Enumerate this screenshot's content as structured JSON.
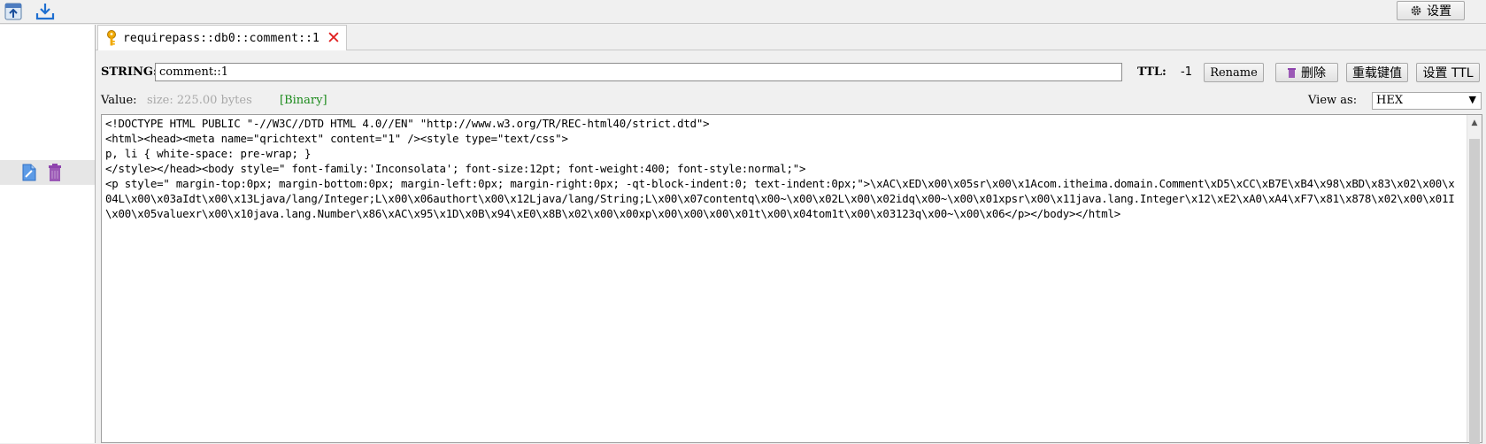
{
  "toolbar": {
    "settings_label": "设置",
    "settings_icon": "gear-icon",
    "icons": [
      "import-icon",
      "download-icon"
    ]
  },
  "left_panel": {
    "icons": [
      "edit-document-icon",
      "trash-icon"
    ]
  },
  "tab": {
    "key_icon": "key-icon",
    "label": "requirepass::db0::comment::1",
    "close": "✕"
  },
  "key_row": {
    "type_label": "STRING:",
    "key_value": "comment::1",
    "ttl_label": "TTL:",
    "ttl_value": "-1",
    "rename_label": "Rename",
    "delete_label": "删除",
    "reload_label": "重载键值",
    "set_ttl_label": "设置 TTL"
  },
  "value_row": {
    "value_label": "Value:",
    "size_label": "size: 225.00 bytes",
    "binary_label": "[Binary]",
    "view_as_label": "View as:",
    "view_as_value": "HEX"
  },
  "editor": {
    "content": "<!DOCTYPE HTML PUBLIC \"-//W3C//DTD HTML 4.0//EN\" \"http://www.w3.org/TR/REC-html40/strict.dtd\">\n<html><head><meta name=\"qrichtext\" content=\"1\" /><style type=\"text/css\">\np, li { white-space: pre-wrap; }\n</style></head><body style=\" font-family:'Inconsolata'; font-size:12pt; font-weight:400; font-style:normal;\">\n<p style=\" margin-top:0px; margin-bottom:0px; margin-left:0px; margin-right:0px; -qt-block-indent:0; text-indent:0px;\">\\xAC\\xED\\x00\\x05sr\\x00\\x1Acom.itheima.domain.Comment\\xD5\\xCC\\xB7E\\xB4\\x98\\xBD\\x83\\x02\\x00\\x04L\\x00\\x03aIdt\\x00\\x13Ljava/lang/Integer;L\\x00\\x06authort\\x00\\x12Ljava/lang/String;L\\x00\\x07contentq\\x00~\\x00\\x02L\\x00\\x02idq\\x00~\\x00\\x01xpsr\\x00\\x11java.lang.Integer\\x12\\xE2\\xA0\\xA4\\xF7\\x81\\x878\\x02\\x00\\x01I\\x00\\x05valuexr\\x00\\x10java.lang.Number\\x86\\xAC\\x95\\x1D\\x0B\\x94\\xE0\\x8B\\x02\\x00\\x00xp\\x00\\x00\\x00\\x01t\\x00\\x04tom1t\\x00\\x03123q\\x00~\\x00\\x06</p></body></html>"
  },
  "colors": {
    "close_red": "#e02020",
    "binary_green": "#1b8a1b",
    "delete_purple": "#8e44ad"
  }
}
